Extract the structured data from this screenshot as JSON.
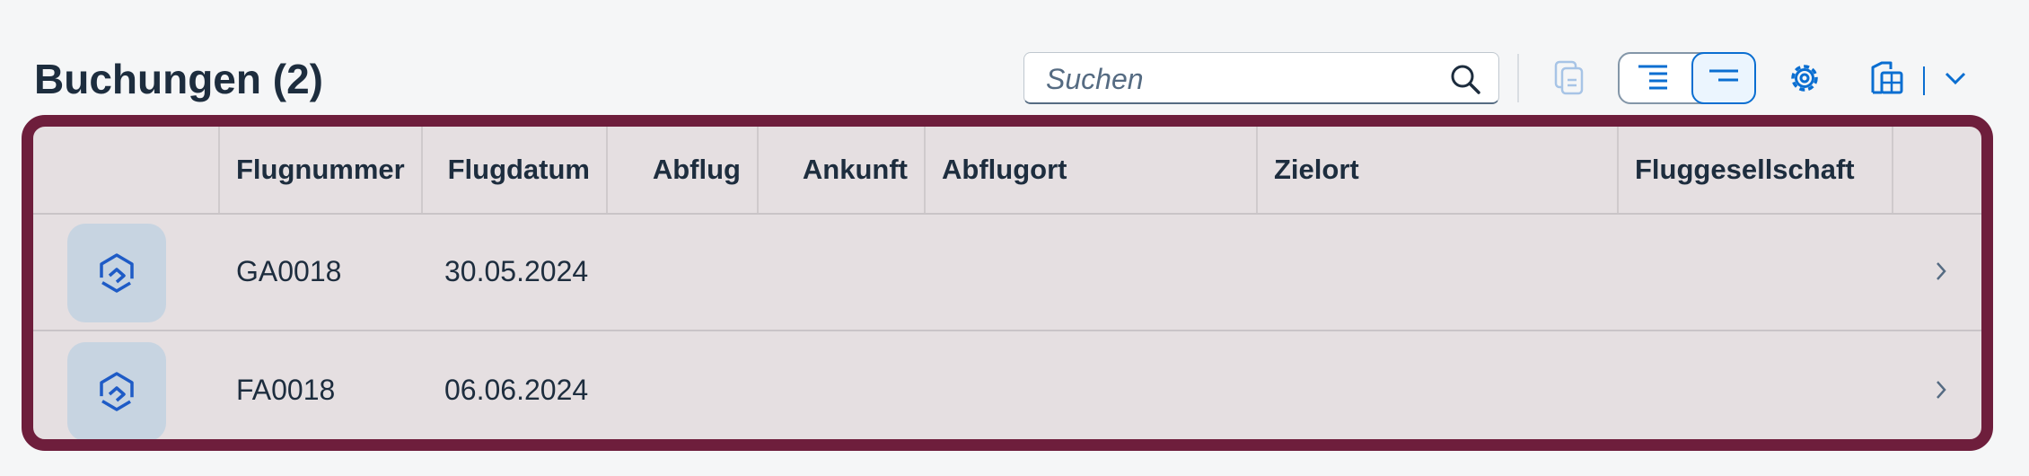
{
  "header": {
    "title": "Buchungen (2)"
  },
  "search": {
    "placeholder": "Suchen",
    "value": ""
  },
  "toolbar": {
    "icons": [
      "copy-icon",
      "align-right-icon",
      "align-top-icon",
      "gear-icon",
      "export-table-icon",
      "chevron-down-icon"
    ],
    "accent_color": "#0a6ed1"
  },
  "table": {
    "columns": [
      "",
      "Flugnummer",
      "Flugdatum",
      "Abflug",
      "Ankunft",
      "Abflugort",
      "Zielort",
      "Fluggesellschaft",
      ""
    ],
    "rows": [
      {
        "flugnummer": "GA0018",
        "flugdatum": "30.05.2024",
        "abflug": "",
        "ankunft": "",
        "abflugort": "",
        "zielort": "",
        "fluggesellschaft": ""
      },
      {
        "flugnummer": "FA0018",
        "flugdatum": "06.06.2024",
        "abflug": "",
        "ankunft": "",
        "abflugort": "",
        "zielort": "",
        "fluggesellschaft": ""
      }
    ],
    "frame_color": "#6e1e3c"
  }
}
